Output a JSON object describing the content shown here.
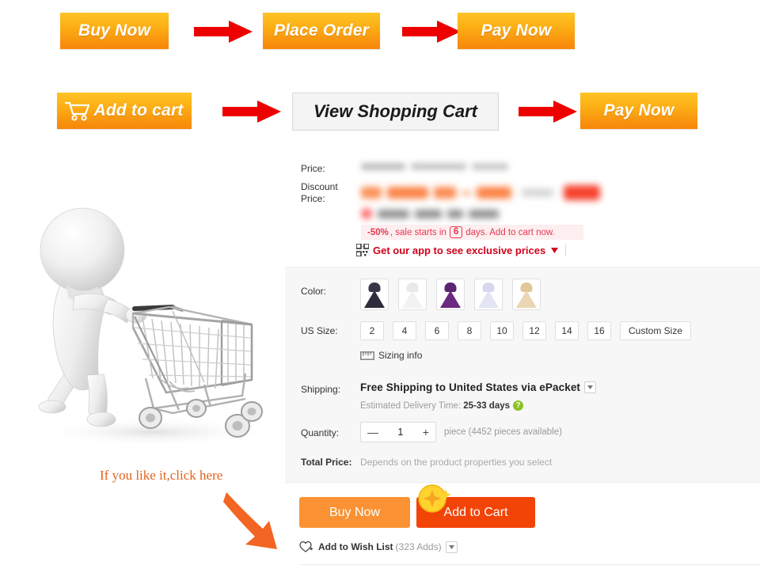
{
  "flow_row_1": {
    "steps": [
      {
        "label": "Buy Now",
        "type": "orange"
      },
      {
        "label": "Place Order",
        "type": "orange"
      },
      {
        "label": "Pay Now",
        "type": "orange"
      }
    ],
    "arrow_icon": "red-right-arrow-icon"
  },
  "flow_row_2": {
    "steps": [
      {
        "label": "Add to cart",
        "type": "orange",
        "icon": "shopping-cart-icon"
      },
      {
        "label": "View Shopping Cart",
        "type": "white"
      },
      {
        "label": "Pay Now",
        "type": "orange"
      }
    ],
    "arrow_icon": "red-right-arrow-icon"
  },
  "illustration": {
    "name": "3d-person-pushing-shopping-cart",
    "hint_text": "If you like it,click here",
    "hint_arrow_icon": "curved-orange-arrow-icon"
  },
  "product": {
    "price": {
      "label": "Price:",
      "value_hidden": true
    },
    "discount_price": {
      "label": "Discount Price:",
      "value_hidden": true
    },
    "sale_banner": {
      "percent": "-50%",
      "text_before_days": ", sale starts in",
      "days": "6",
      "text_after_days": "days. Add to cart now."
    },
    "app_promo": {
      "icon": "qr-code-icon",
      "label": "Get our app to see exclusive prices",
      "caret_icon": "caret-down-icon"
    },
    "color": {
      "label": "Color:",
      "swatches": [
        {
          "name": "navy-black-dress",
          "top": "#3a3647",
          "skirt": "#2e2b3a"
        },
        {
          "name": "white-dress",
          "top": "#e9e9e9",
          "skirt": "#f2f2f2"
        },
        {
          "name": "purple-dress",
          "top": "#5d2470",
          "skirt": "#6b2a80"
        },
        {
          "name": "lavender-dress",
          "top": "#d7d8ef",
          "skirt": "#e3e4f4"
        },
        {
          "name": "champagne-dress",
          "top": "#e2c79b",
          "skirt": "#ead6b4"
        }
      ]
    },
    "us_size": {
      "label": "US Size:",
      "options": [
        "2",
        "4",
        "6",
        "8",
        "10",
        "12",
        "14",
        "16"
      ],
      "custom_option": "Custom Size"
    },
    "sizing_info": {
      "icon": "ruler-icon",
      "label": "Sizing info"
    },
    "shipping": {
      "label": "Shipping:",
      "method": "Free Shipping to United States via ePacket",
      "caret_icon": "caret-down-icon",
      "estimate_label": "Estimated Delivery Time:",
      "estimate_value": "25-33 days",
      "help_icon": "question-mark-icon",
      "help_glyph": "?"
    },
    "quantity": {
      "label": "Quantity:",
      "minus_icon": "minus-icon",
      "minus_glyph": "—",
      "value": "1",
      "plus_icon": "plus-icon",
      "plus_glyph": "+",
      "availability": "piece (4452 pieces available)"
    },
    "total_price": {
      "label": "Total Price:",
      "value": "Depends on the product properties you select"
    },
    "actions": {
      "buy_now": "Buy Now",
      "add_to_cart": "Add to Cart",
      "coin_icon": "gold-coin-sparkle-icon"
    },
    "wish_list": {
      "icon": "heart-plus-icon",
      "label": "Add to Wish List",
      "count": "(323 Adds)",
      "caret_icon": "caret-down-icon"
    }
  },
  "colors": {
    "orange_button_top": "#fdc324",
    "orange_button_bottom": "#f7860a",
    "arrow_red": "#ed0000",
    "cta_buy_orange": "#fa9234",
    "cta_add_red": "#f34408",
    "sale_red": "#e8384f",
    "app_promo_red": "#d0021b",
    "hint_orange": "#e2621c",
    "panel_gray": "#f7f7f7"
  }
}
